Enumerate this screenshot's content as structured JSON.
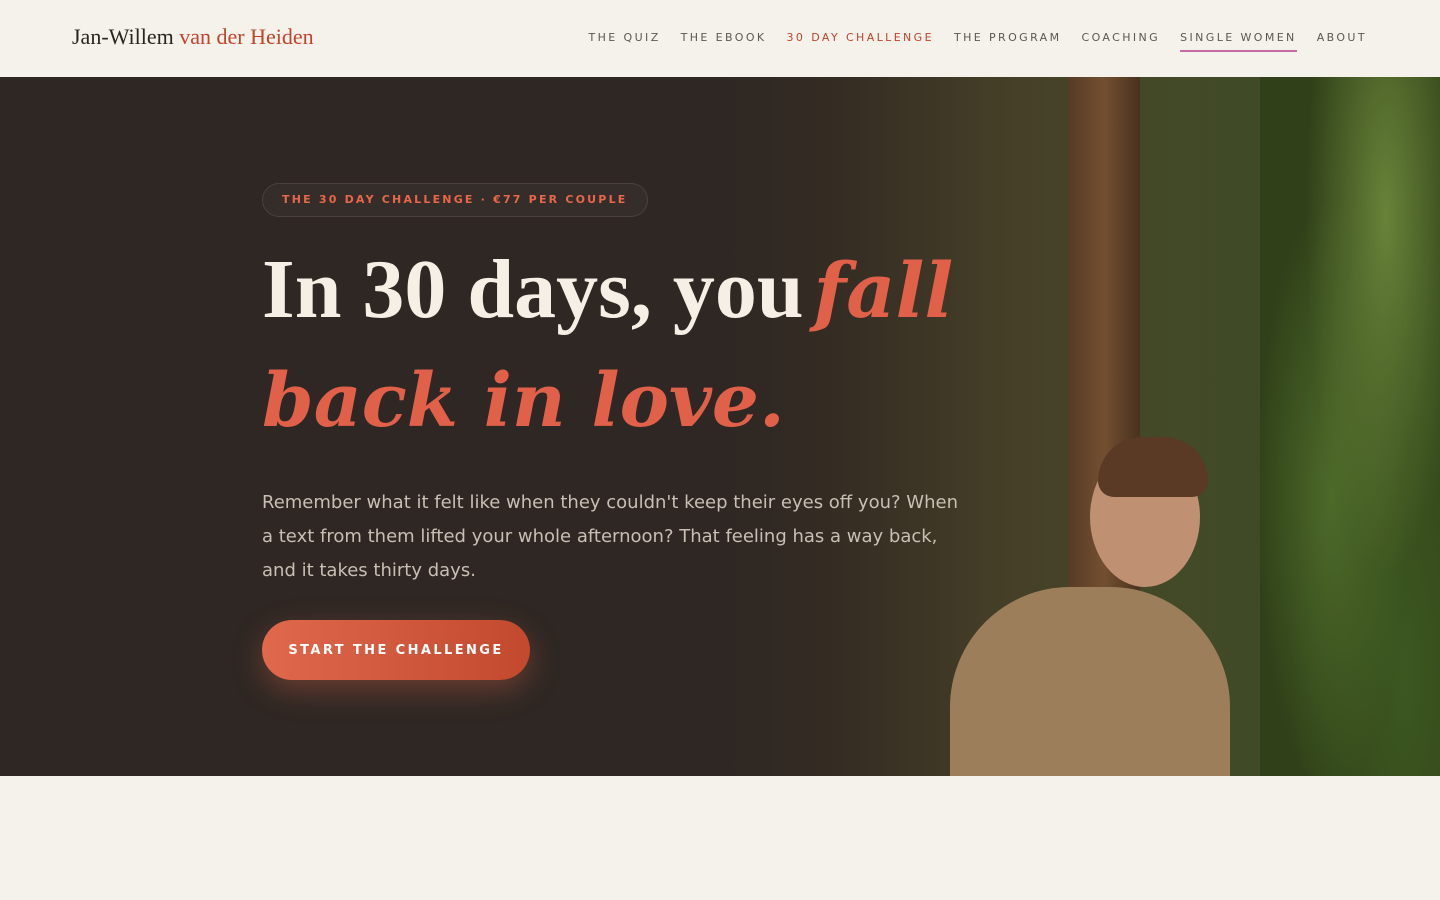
{
  "brand": {
    "name_first": "Jan-Willem",
    "name_accent": "van der Heiden"
  },
  "nav": [
    {
      "label": "THE QUIZ"
    },
    {
      "label": "THE EBOOK"
    },
    {
      "label": "30 DAY CHALLENGE"
    },
    {
      "label": "THE PROGRAM"
    },
    {
      "label": "COACHING"
    },
    {
      "label": "SINGLE WOMEN"
    },
    {
      "label": "ABOUT"
    }
  ],
  "hero": {
    "badge": "THE 30 DAY CHALLENGE · €77 PER COUPLE",
    "headline_plain": "In 30 days, you",
    "headline_script_1": "fall",
    "headline_script_2": "back in love.",
    "lede": "Remember what it felt like when they couldn't keep their eyes off you? When a text from them lifted your whole afternoon? That feeling has a way back, and it takes thirty days.",
    "cta": "START THE CHALLENGE"
  },
  "colors": {
    "accent": "#c0452a",
    "script": "#e0604a",
    "nav_underline": "#c46aa9",
    "hero_bg": "#2e2723",
    "page_bg": "#f5f1eb"
  }
}
